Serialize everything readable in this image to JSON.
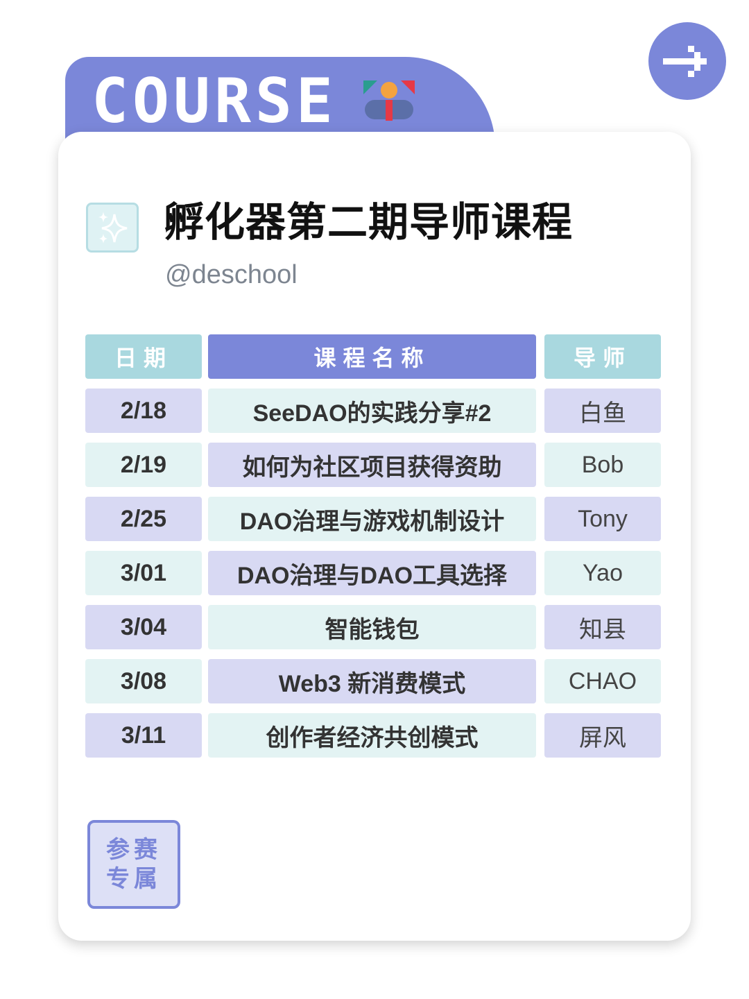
{
  "header": {
    "course_word": "COURSE",
    "logo_icon": "deschool-logo-icon",
    "arrow_icon": "arrow-right-icon"
  },
  "card": {
    "title": "孵化器第二期导师课程",
    "handle": "@deschool",
    "sparkle_icon": "sparkle-icon"
  },
  "table": {
    "headers": {
      "date": "日期",
      "name": "课程名称",
      "tutor": "导师"
    },
    "rows": [
      {
        "date": "2/18",
        "name": "SeeDAO的实践分享#2",
        "tutor": "白鱼"
      },
      {
        "date": "2/19",
        "name": "如何为社区项目获得资助",
        "tutor": "Bob"
      },
      {
        "date": "2/25",
        "name": "DAO治理与游戏机制设计",
        "tutor": "Tony"
      },
      {
        "date": "3/01",
        "name": "DAO治理与DAO工具选择",
        "tutor": "Yao"
      },
      {
        "date": "3/04",
        "name": "智能钱包",
        "tutor": "知县"
      },
      {
        "date": "3/08",
        "name": "Web3 新消费模式",
        "tutor": "CHAO"
      },
      {
        "date": "3/11",
        "name": "创作者经济共创模式",
        "tutor": "屏风"
      }
    ]
  },
  "badge": {
    "line1": "参赛",
    "line2": "专属"
  },
  "colors": {
    "accent_purple": "#7b87d9",
    "accent_teal": "#a9d8df",
    "row_purple": "#d8d9f3",
    "row_teal": "#e3f3f3"
  }
}
